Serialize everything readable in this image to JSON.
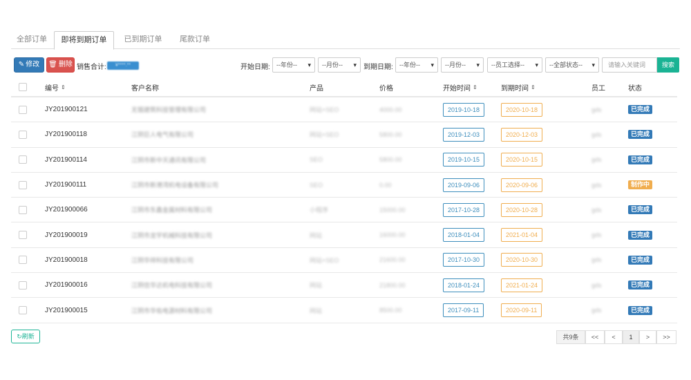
{
  "tabs": [
    {
      "label": "全部订单",
      "active": false
    },
    {
      "label": "即将到期订单",
      "active": true
    },
    {
      "label": "已到期订单",
      "active": false
    },
    {
      "label": "尾款订单",
      "active": false
    }
  ],
  "toolbar": {
    "edit_label": "修改",
    "delete_label": "删除",
    "sales_label": "销售合计:",
    "sales_value": "¥****.**",
    "start_date_label": "开始日期:",
    "end_date_label": "到期日期:",
    "start_year": "--年份--",
    "start_month": "--月份--",
    "end_year": "--年份--",
    "end_month": "--月份--",
    "staff_select": "--员工选择--",
    "status_select": "--全部状态--",
    "search_placeholder": "请输入关键词",
    "search_label": "搜索"
  },
  "table": {
    "headers": {
      "id": "编号",
      "customer": "客户名称",
      "product": "产品",
      "price": "价格",
      "start": "开始时间",
      "end": "到期时间",
      "staff": "员工",
      "status": "状态"
    },
    "rows": [
      {
        "id": "JY201900121",
        "customer": "无锡建筑科技管理有限公司",
        "product": "网站+SEO",
        "price": "4000.00",
        "start": "2019-10-18",
        "end": "2020-10-18",
        "staff": "gds",
        "status": "已完成",
        "status_color": "#337ab7"
      },
      {
        "id": "JY201900118",
        "customer": "江阴巨人电气有限公司",
        "product": "网站+SEO",
        "price": "5800.00",
        "start": "2019-12-03",
        "end": "2020-12-03",
        "staff": "gds",
        "status": "已完成",
        "status_color": "#337ab7"
      },
      {
        "id": "JY201900114",
        "customer": "江阴市新中天通讯有限公司",
        "product": "SEO",
        "price": "5800.00",
        "start": "2019-10-15",
        "end": "2020-10-15",
        "staff": "gds",
        "status": "已完成",
        "status_color": "#337ab7"
      },
      {
        "id": "JY201900111",
        "customer": "江阴市新港湾机电设备有限公司",
        "product": "SEO",
        "price": "0.00",
        "start": "2019-09-06",
        "end": "2020-09-06",
        "staff": "gds",
        "status": "制作中",
        "status_color": "#f0ad4e"
      },
      {
        "id": "JY201900066",
        "customer": "江阴市东鑫金属材料有限公司",
        "product": "小程序",
        "price": "15000.00",
        "start": "2017-10-28",
        "end": "2020-10-28",
        "staff": "gds",
        "status": "已完成",
        "status_color": "#337ab7"
      },
      {
        "id": "JY201900019",
        "customer": "江阴市龙宇机械科技有限公司",
        "product": "网站",
        "price": "16000.00",
        "start": "2018-01-04",
        "end": "2021-01-04",
        "staff": "gds",
        "status": "已完成",
        "status_color": "#337ab7"
      },
      {
        "id": "JY201900018",
        "customer": "江阴华祥科技有限公司",
        "product": "网站+SEO",
        "price": "21600.00",
        "start": "2017-10-30",
        "end": "2020-10-30",
        "staff": "gds",
        "status": "已完成",
        "status_color": "#337ab7"
      },
      {
        "id": "JY201900016",
        "customer": "江阴信华达机电科技有限公司",
        "product": "网站",
        "price": "21800.00",
        "start": "2018-01-24",
        "end": "2021-01-24",
        "staff": "gds",
        "status": "已完成",
        "status_color": "#337ab7"
      },
      {
        "id": "JY201900015",
        "customer": "江阴市华佑电源材料有限公司",
        "product": "网站",
        "price": "8500.00",
        "start": "2017-09-11",
        "end": "2020-09-11",
        "staff": "gds",
        "status": "已完成",
        "status_color": "#337ab7"
      }
    ]
  },
  "footer": {
    "refresh_label": "刷新",
    "total_label": "共9条",
    "first": "<<",
    "prev": "<",
    "page": "1",
    "next": ">",
    "last": ">>"
  }
}
